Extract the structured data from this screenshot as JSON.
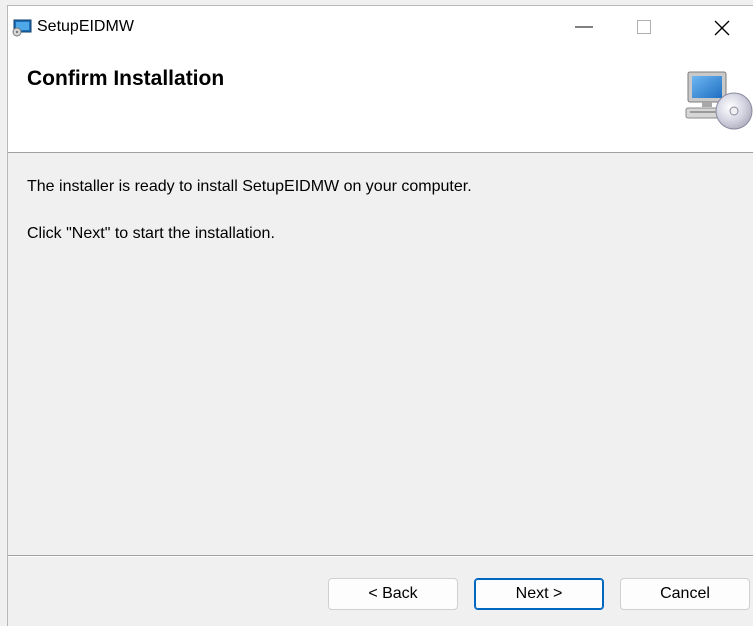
{
  "window": {
    "title": "SetupEIDMW",
    "icon": "installer-app-icon",
    "controls": {
      "minimize_icon": "minimize-icon",
      "maximize_icon": "maximize-icon",
      "close_icon": "close-icon"
    }
  },
  "header": {
    "title": "Confirm Installation",
    "banner_icon": "computer-with-cd-icon"
  },
  "body": {
    "line1": "The installer is ready to install SetupEIDMW on your computer.",
    "line2": "Click \"Next\" to start the installation."
  },
  "buttons": {
    "back": "< Back",
    "next": "Next >",
    "cancel": "Cancel"
  },
  "colors": {
    "accent": "#0067c0",
    "background": "#f0f0f0",
    "header_bg": "#ffffff"
  }
}
